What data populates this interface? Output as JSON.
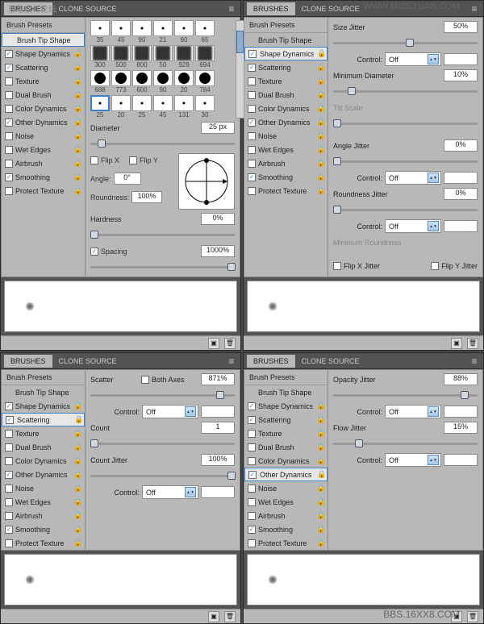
{
  "watermarks": {
    "top_left": "思缘设计论坛",
    "top_right": "WWW.MISSYUAN.COM",
    "bottom_right": "BBS.16XX8.COM"
  },
  "tabs": {
    "brushes": "BRUSHES",
    "clone": "CLONE SOURCE"
  },
  "side": {
    "brush_presets": "Brush Presets",
    "brush_tip": "Brush Tip Shape",
    "shape_dyn": "Shape Dynamics",
    "scattering": "Scattering",
    "texture": "Texture",
    "dual": "Dual Brush",
    "color_dyn": "Color Dynamics",
    "other_dyn": "Other Dynamics",
    "noise": "Noise",
    "wet": "Wet Edges",
    "airbrush": "Airbrush",
    "smoothing": "Smoothing",
    "protect": "Protect Texture"
  },
  "tip": {
    "thumbs": [
      35,
      45,
      90,
      21,
      60,
      65,
      300,
      500,
      800,
      50,
      929,
      694,
      688,
      773,
      600,
      90,
      20,
      784,
      25,
      20,
      25,
      45,
      131,
      30
    ],
    "diameter": "Diameter",
    "diameter_val": "25 px",
    "flipx": "Flip X",
    "flipy": "Flip Y",
    "angle": "Angle:",
    "angle_val": "0°",
    "roundness": "Roundness:",
    "roundness_val": "100%",
    "hardness": "Hardness",
    "hardness_val": "0%",
    "spacing": "Spacing",
    "spacing_val": "1000%"
  },
  "shape": {
    "size_jitter": "Size Jitter",
    "size_val": "50%",
    "control": "Control:",
    "off": "Off",
    "min_dia": "Minimum Diameter",
    "min_val": "10%",
    "tilt": "Tilt Scale",
    "angle_jitter": "Angle Jitter",
    "angle_val": "0%",
    "round_jitter": "Roundness Jitter",
    "round_val": "0%",
    "min_round": "Minimum Roundness",
    "flipxj": "Flip X Jitter",
    "flipyj": "Flip Y Jitter"
  },
  "scat": {
    "scatter": "Scatter",
    "both": "Both Axes",
    "scatter_val": "871%",
    "control": "Control:",
    "off": "Off",
    "count": "Count",
    "count_val": "1",
    "count_jitter": "Count Jitter",
    "cj_val": "100%"
  },
  "other": {
    "opacity": "Opacity Jitter",
    "opacity_val": "88%",
    "control": "Control:",
    "off": "Off",
    "flow": "Flow Jitter",
    "flow_val": "15%"
  }
}
